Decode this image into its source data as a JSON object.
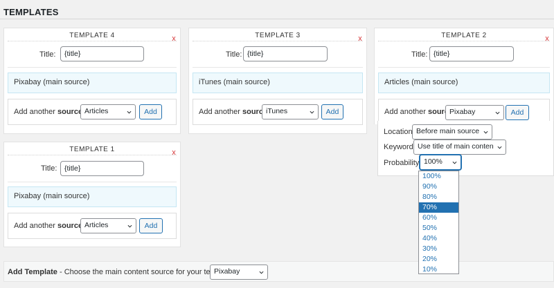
{
  "section_title": "TEMPLATES",
  "templates": [
    {
      "title": "TEMPLATE 4",
      "close": "x",
      "title_label": "Title:",
      "title_value": "{title}",
      "main_source": "Pixabay (main source)",
      "add_label_pre": "Add another ",
      "add_label_bold": "source",
      "add_label_post": ":",
      "add_select": "Articles",
      "add_button": "Add"
    },
    {
      "title": "TEMPLATE 3",
      "close": "x",
      "title_label": "Title:",
      "title_value": "{title}",
      "main_source": "iTunes (main source)",
      "add_label_pre": "Add another ",
      "add_label_bold": "source",
      "add_label_post": ":",
      "add_select": "iTunes",
      "add_button": "Add"
    },
    {
      "title": "TEMPLATE 2",
      "close": "x",
      "title_label": "Title:",
      "title_value": "{title}",
      "main_source": "Articles (main source)",
      "add_label_pre": "Add another ",
      "add_label_bold": "source",
      "add_label_post": ":",
      "add_select": "Pixabay",
      "add_button": "Add"
    },
    {
      "title": "TEMPLATE 1",
      "close": "x",
      "title_label": "Title:",
      "title_value": "{title}",
      "main_source": "Pixabay (main source)",
      "add_label_pre": "Add another ",
      "add_label_bold": "source",
      "add_label_post": ":",
      "add_select": "Articles",
      "add_button": "Add"
    }
  ],
  "options_popup": {
    "location_label": "Location:",
    "location_value": "Before main source",
    "keyword_label": "Keyword:",
    "keyword_value": "Use title of main conten",
    "probability_label": "Probability:",
    "probability_value": "100%",
    "probability_options": [
      "100%",
      "90%",
      "80%",
      "70%",
      "60%",
      "50%",
      "40%",
      "30%",
      "20%",
      "10%"
    ],
    "probability_highlighted": "70%"
  },
  "bottom": {
    "label_bold": "Add Template",
    "label_rest": " - Choose the main content source for your template:",
    "select_value": "Pixabay"
  },
  "colors": {
    "accent": "#2271b1",
    "close": "#d63638",
    "main_source_bg": "#eff9fd"
  }
}
